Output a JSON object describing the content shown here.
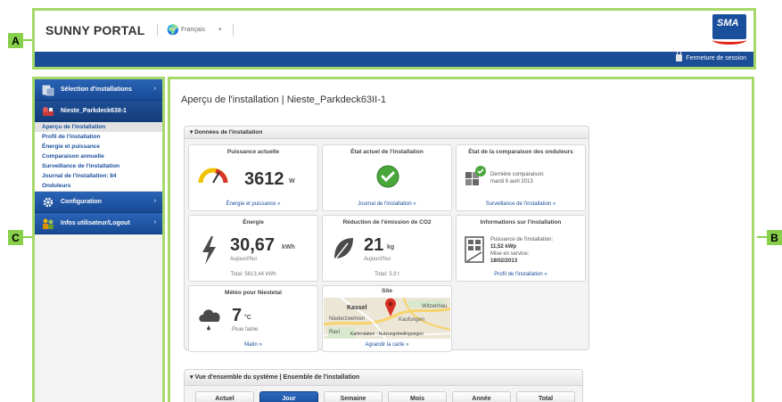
{
  "callouts": {
    "a": "A",
    "b": "B",
    "c": "C"
  },
  "header": {
    "brand": "SUNNY PORTAL",
    "language": "Français",
    "logo_text": "SMA",
    "logout_label": "Fermeture de session",
    "bar_color": "#1c4d97"
  },
  "sidebar": {
    "selection_label": "Sélection d'installations",
    "plant_label": "Nieste_Parkdeck63II-1",
    "items": [
      {
        "label": "Aperçu de l'installation"
      },
      {
        "label": "Profil de l'installation"
      },
      {
        "label": "Énergie et puissance"
      },
      {
        "label": "Comparaison annuelle"
      },
      {
        "label": "Surveillance de l'installation"
      },
      {
        "label": "Journal de l'installation: 84"
      },
      {
        "label": "Onduleurs"
      }
    ],
    "config_label": "Configuration",
    "user_label": "Infos utilisateur/Logout"
  },
  "main": {
    "title": "Aperçu de l'installation | Nieste_Parkdeck63II-1",
    "panel_title": "▾ Données de l'installation",
    "tiles": {
      "power": {
        "title": "Puissance actuelle",
        "value": "3612",
        "unit": "W",
        "link": "Énergie et puissance »"
      },
      "state": {
        "title": "État actuel de l'installation",
        "link": "Journal de l'installation »"
      },
      "inverter": {
        "title": "État de la comparaison des onduleurs",
        "line1": "Dernière comparaison:",
        "line2": "mardi 9 avril 2013",
        "link": "Surveillance de l'installation »"
      },
      "energy": {
        "title": "Énergie",
        "value": "30,67",
        "unit": "kWh",
        "sub": "Aujourd'hui",
        "foot": "Total: 5613,44 kWh"
      },
      "co2": {
        "title": "Réduction de l'émission de CO2",
        "value": "21",
        "unit": "kg",
        "sub": "Aujourd'hui",
        "foot": "Total: 3,9 t"
      },
      "info": {
        "title": "Informations sur l'installation",
        "power_label": "Puissance de l'installation:",
        "power_value": "11,52 kWp",
        "date_label": "Mise en service:",
        "date_value": "18/02/2013",
        "link": "Profil de l'installation »"
      },
      "weather": {
        "title": "Météo pour Niestetal",
        "value": "7",
        "unit": "°C",
        "sub": "Pluie faible",
        "link": "Matin »"
      },
      "site": {
        "title": "Site",
        "city": "Kassel",
        "town1": "Witzenhau",
        "town2": "Niederzwehren",
        "town3": "Kaufungen",
        "town4": "Ravi",
        "map_credit": "Kartendaten · Nutzungsbedingungen",
        "link": "Agrandir la carte »"
      }
    },
    "panel2_title": "▾ Vue d'ensemble du système  |  Ensemble de l'installation",
    "tabs": [
      "Actuel",
      "Jour",
      "Semaine",
      "Mois",
      "Année",
      "Total"
    ],
    "active_tab": "Jour"
  }
}
